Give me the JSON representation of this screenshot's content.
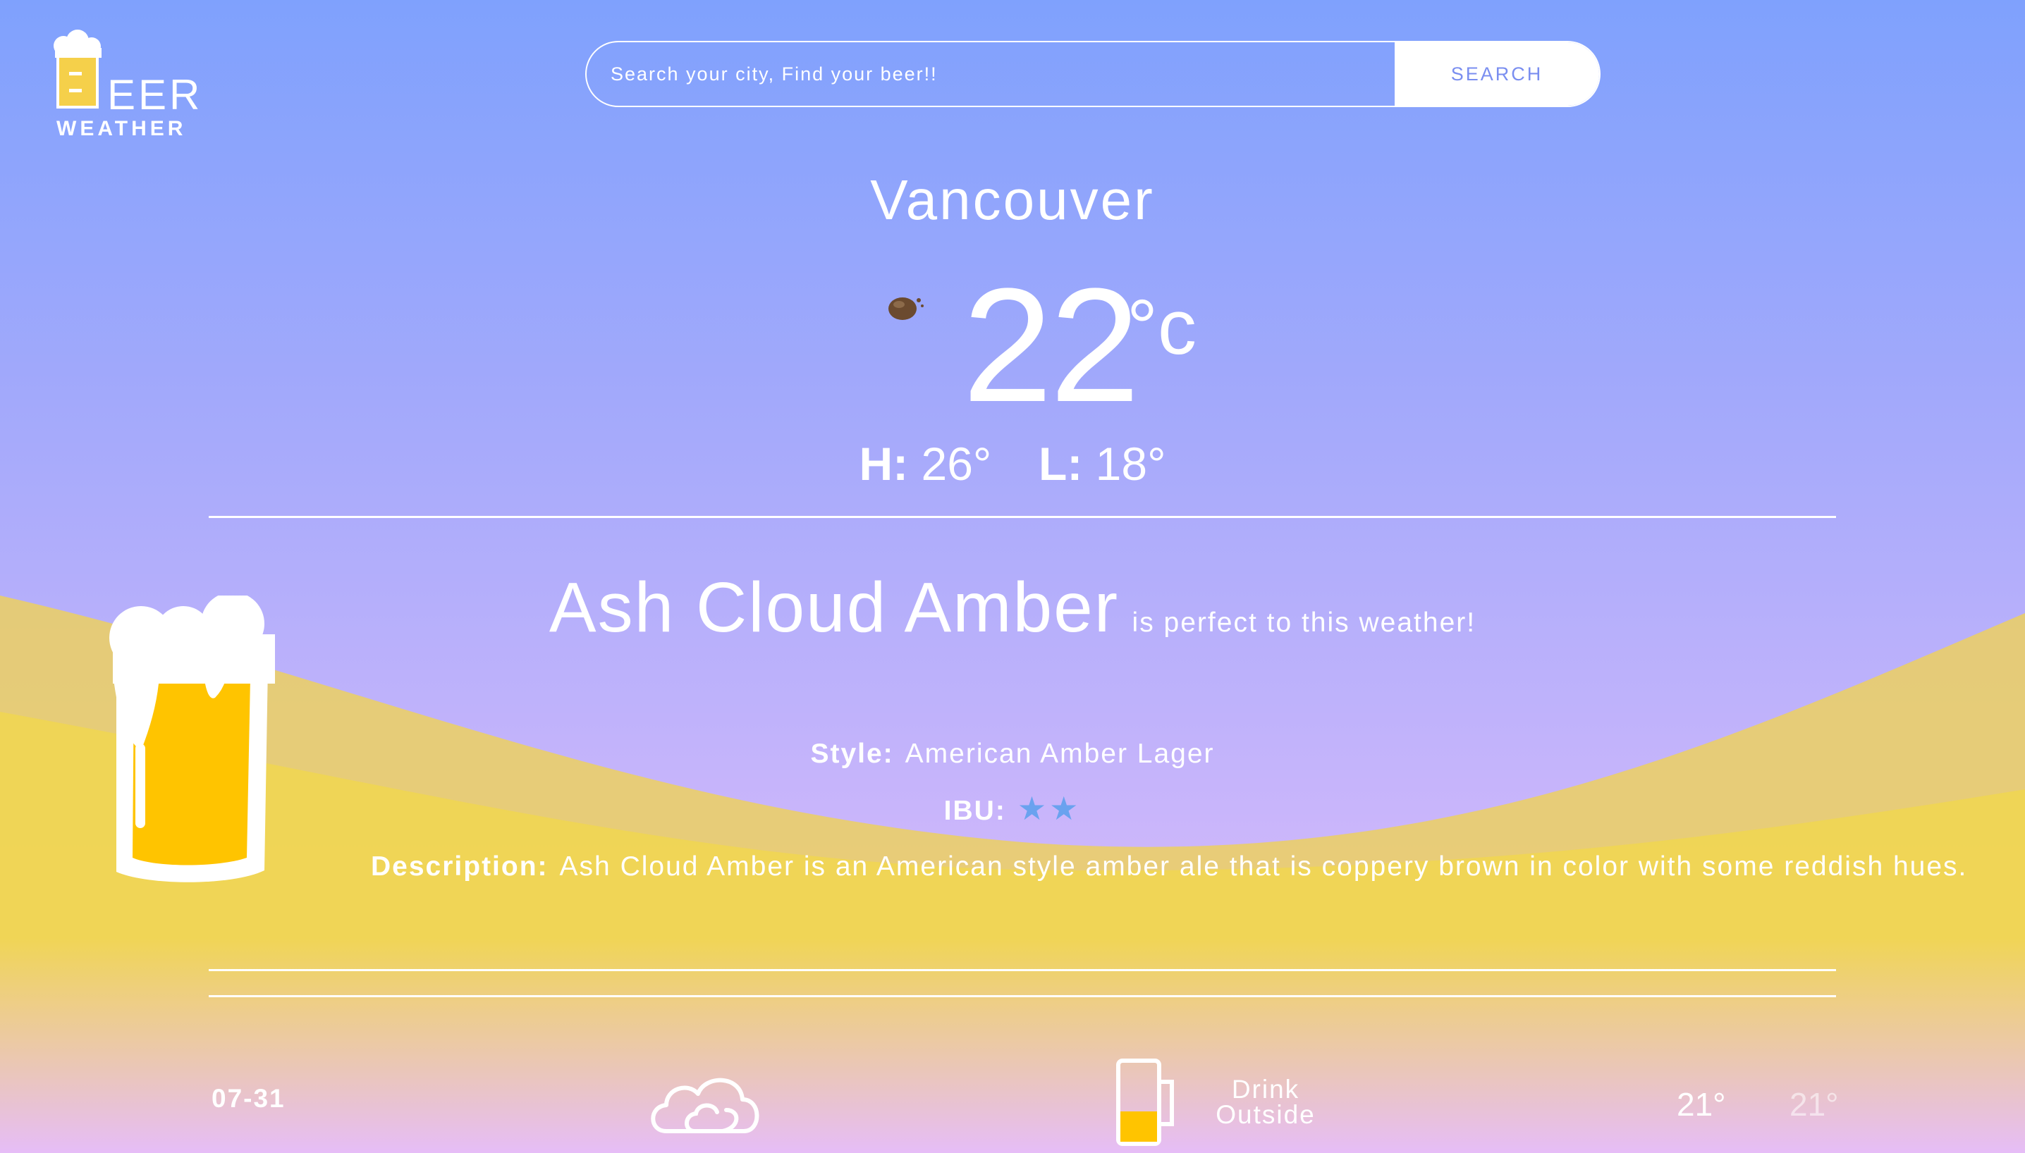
{
  "logo": {
    "eer": "EER",
    "weather": "WEATHER"
  },
  "search": {
    "placeholder": "Search your city, Find your beer!!",
    "button_label": "SEARCH"
  },
  "weather": {
    "city": "Vancouver",
    "temp": "22",
    "unit": "°c",
    "icon": "weather-condition-icon",
    "high_label": "H:",
    "high": "26°",
    "low_label": "L:",
    "low": "18°"
  },
  "beer": {
    "name": "Ash Cloud Amber",
    "tagline": "is perfect to this weather!",
    "style_label": "Style:",
    "style": "American Amber Lager",
    "ibu_label": "IBU:",
    "ibu_stars": "★★",
    "description_label": "Description:",
    "description": "Ash Cloud Amber is an American style amber ale that is coppery brown in color with some reddish hues."
  },
  "forecast": [
    {
      "date": "07-31",
      "icon": "cloud-icon",
      "label_line1": "Drink",
      "label_line2": "Outside",
      "high": "21°",
      "low": "21°"
    }
  ],
  "colors": {
    "accent": "#7a8ef0",
    "hill_yellow": "#f3d24a",
    "beer": "#ffc400",
    "star": "#6aa2ef"
  }
}
